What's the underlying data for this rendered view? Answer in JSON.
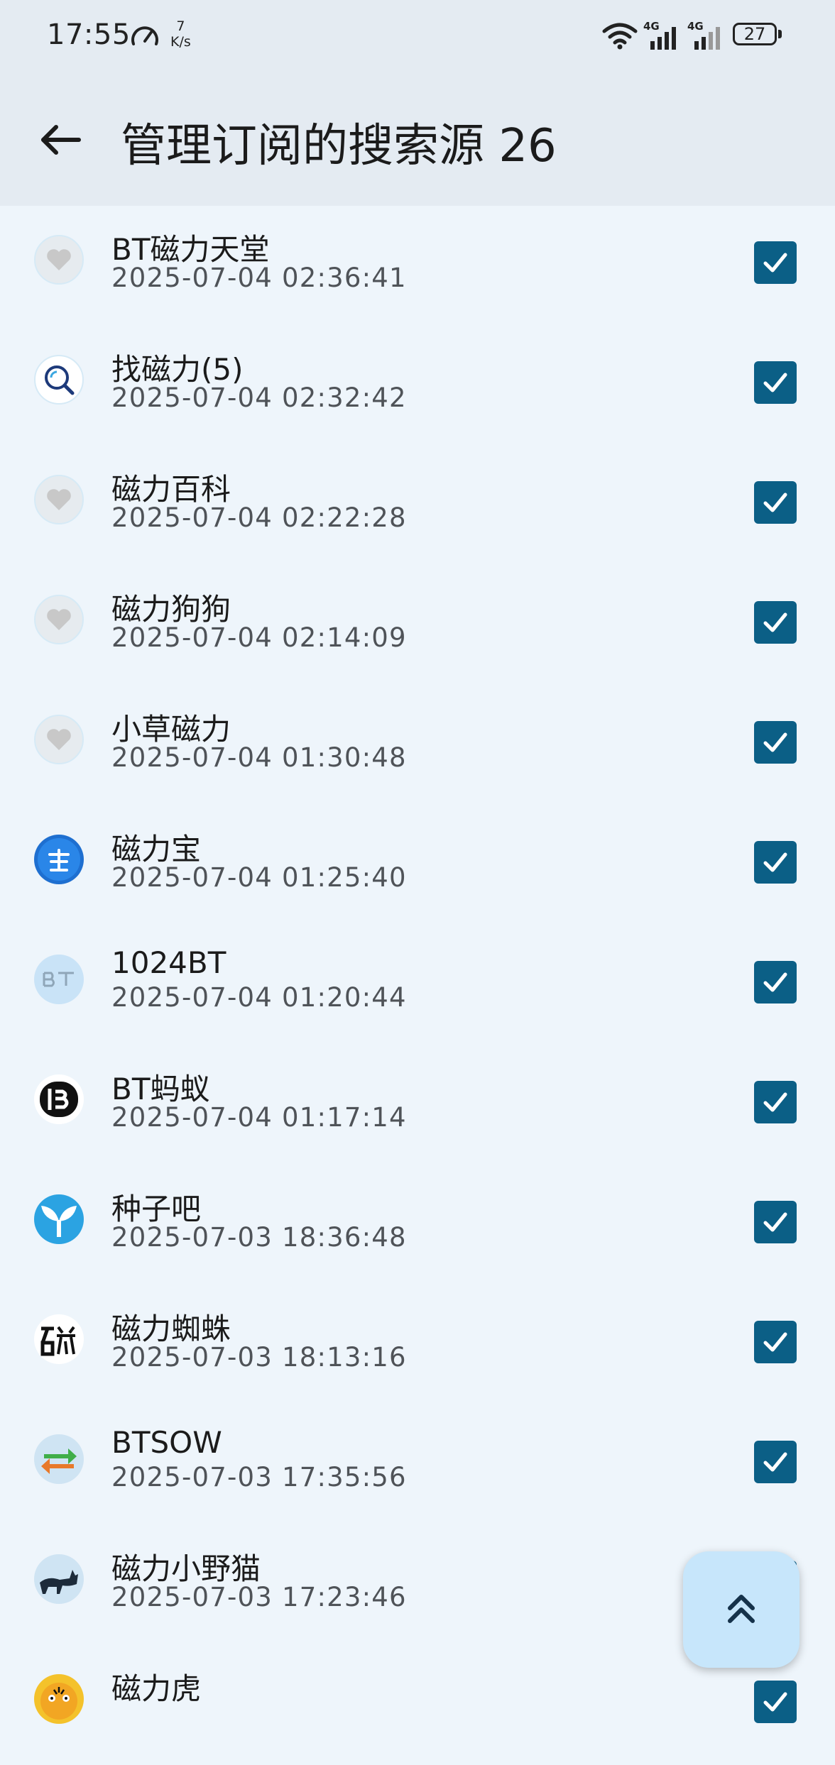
{
  "status_bar": {
    "time": "17:55",
    "net_speed_value": "7",
    "net_speed_unit": "K/s",
    "signal_1_label": "4G",
    "signal_2_label": "4G",
    "battery": "27",
    "icons": [
      "speedometer-icon",
      "wifi-icon",
      "signal-icon",
      "signal-icon",
      "battery-icon"
    ]
  },
  "app_bar": {
    "back_icon": "arrow-left-icon",
    "title": "管理订阅的搜索源 26"
  },
  "colors": {
    "background": "#eef5fb",
    "app_bar": "#e4ebf2",
    "checkbox": "#0b5f86",
    "fab": "#c7e6fb"
  },
  "sources": [
    {
      "name": "BT磁力天堂",
      "date": "2025-07-04 02:36:41",
      "checked": true,
      "icon": "heart-placeholder-icon"
    },
    {
      "name": "找磁力(5)",
      "date": "2025-07-04 02:32:42",
      "checked": true,
      "icon": "magnifier-logo-icon"
    },
    {
      "name": "磁力百科",
      "date": "2025-07-04 02:22:28",
      "checked": true,
      "icon": "heart-placeholder-icon"
    },
    {
      "name": "磁力狗狗",
      "date": "2025-07-04 02:14:09",
      "checked": true,
      "icon": "heart-placeholder-icon"
    },
    {
      "name": "小草磁力",
      "date": "2025-07-04 01:30:48",
      "checked": true,
      "icon": "heart-placeholder-icon"
    },
    {
      "name": "磁力宝",
      "date": "2025-07-04 01:25:40",
      "checked": true,
      "icon": "bao-logo-icon"
    },
    {
      "name": "1024BT",
      "date": "2025-07-04 01:20:44",
      "checked": true,
      "icon": "bt-logo-icon"
    },
    {
      "name": "BT蚂蚁",
      "date": "2025-07-04 01:17:14",
      "checked": true,
      "icon": "b-logo-icon"
    },
    {
      "name": "种子吧",
      "date": "2025-07-03 18:36:48",
      "checked": true,
      "icon": "sprout-logo-icon"
    },
    {
      "name": "磁力蜘蛛",
      "date": "2025-07-03 18:13:16",
      "checked": true,
      "icon": "ci-glyph-logo-icon"
    },
    {
      "name": "BTSOW",
      "date": "2025-07-03 17:35:56",
      "checked": true,
      "icon": "arrows-logo-icon"
    },
    {
      "name": "磁力小野猫",
      "date": "2025-07-03 17:23:46",
      "checked": true,
      "icon": "cat-logo-icon"
    },
    {
      "name": "磁力虎",
      "date": "",
      "checked": true,
      "icon": "tiger-logo-icon"
    }
  ],
  "fab": {
    "icon": "double-chevron-up-icon"
  }
}
